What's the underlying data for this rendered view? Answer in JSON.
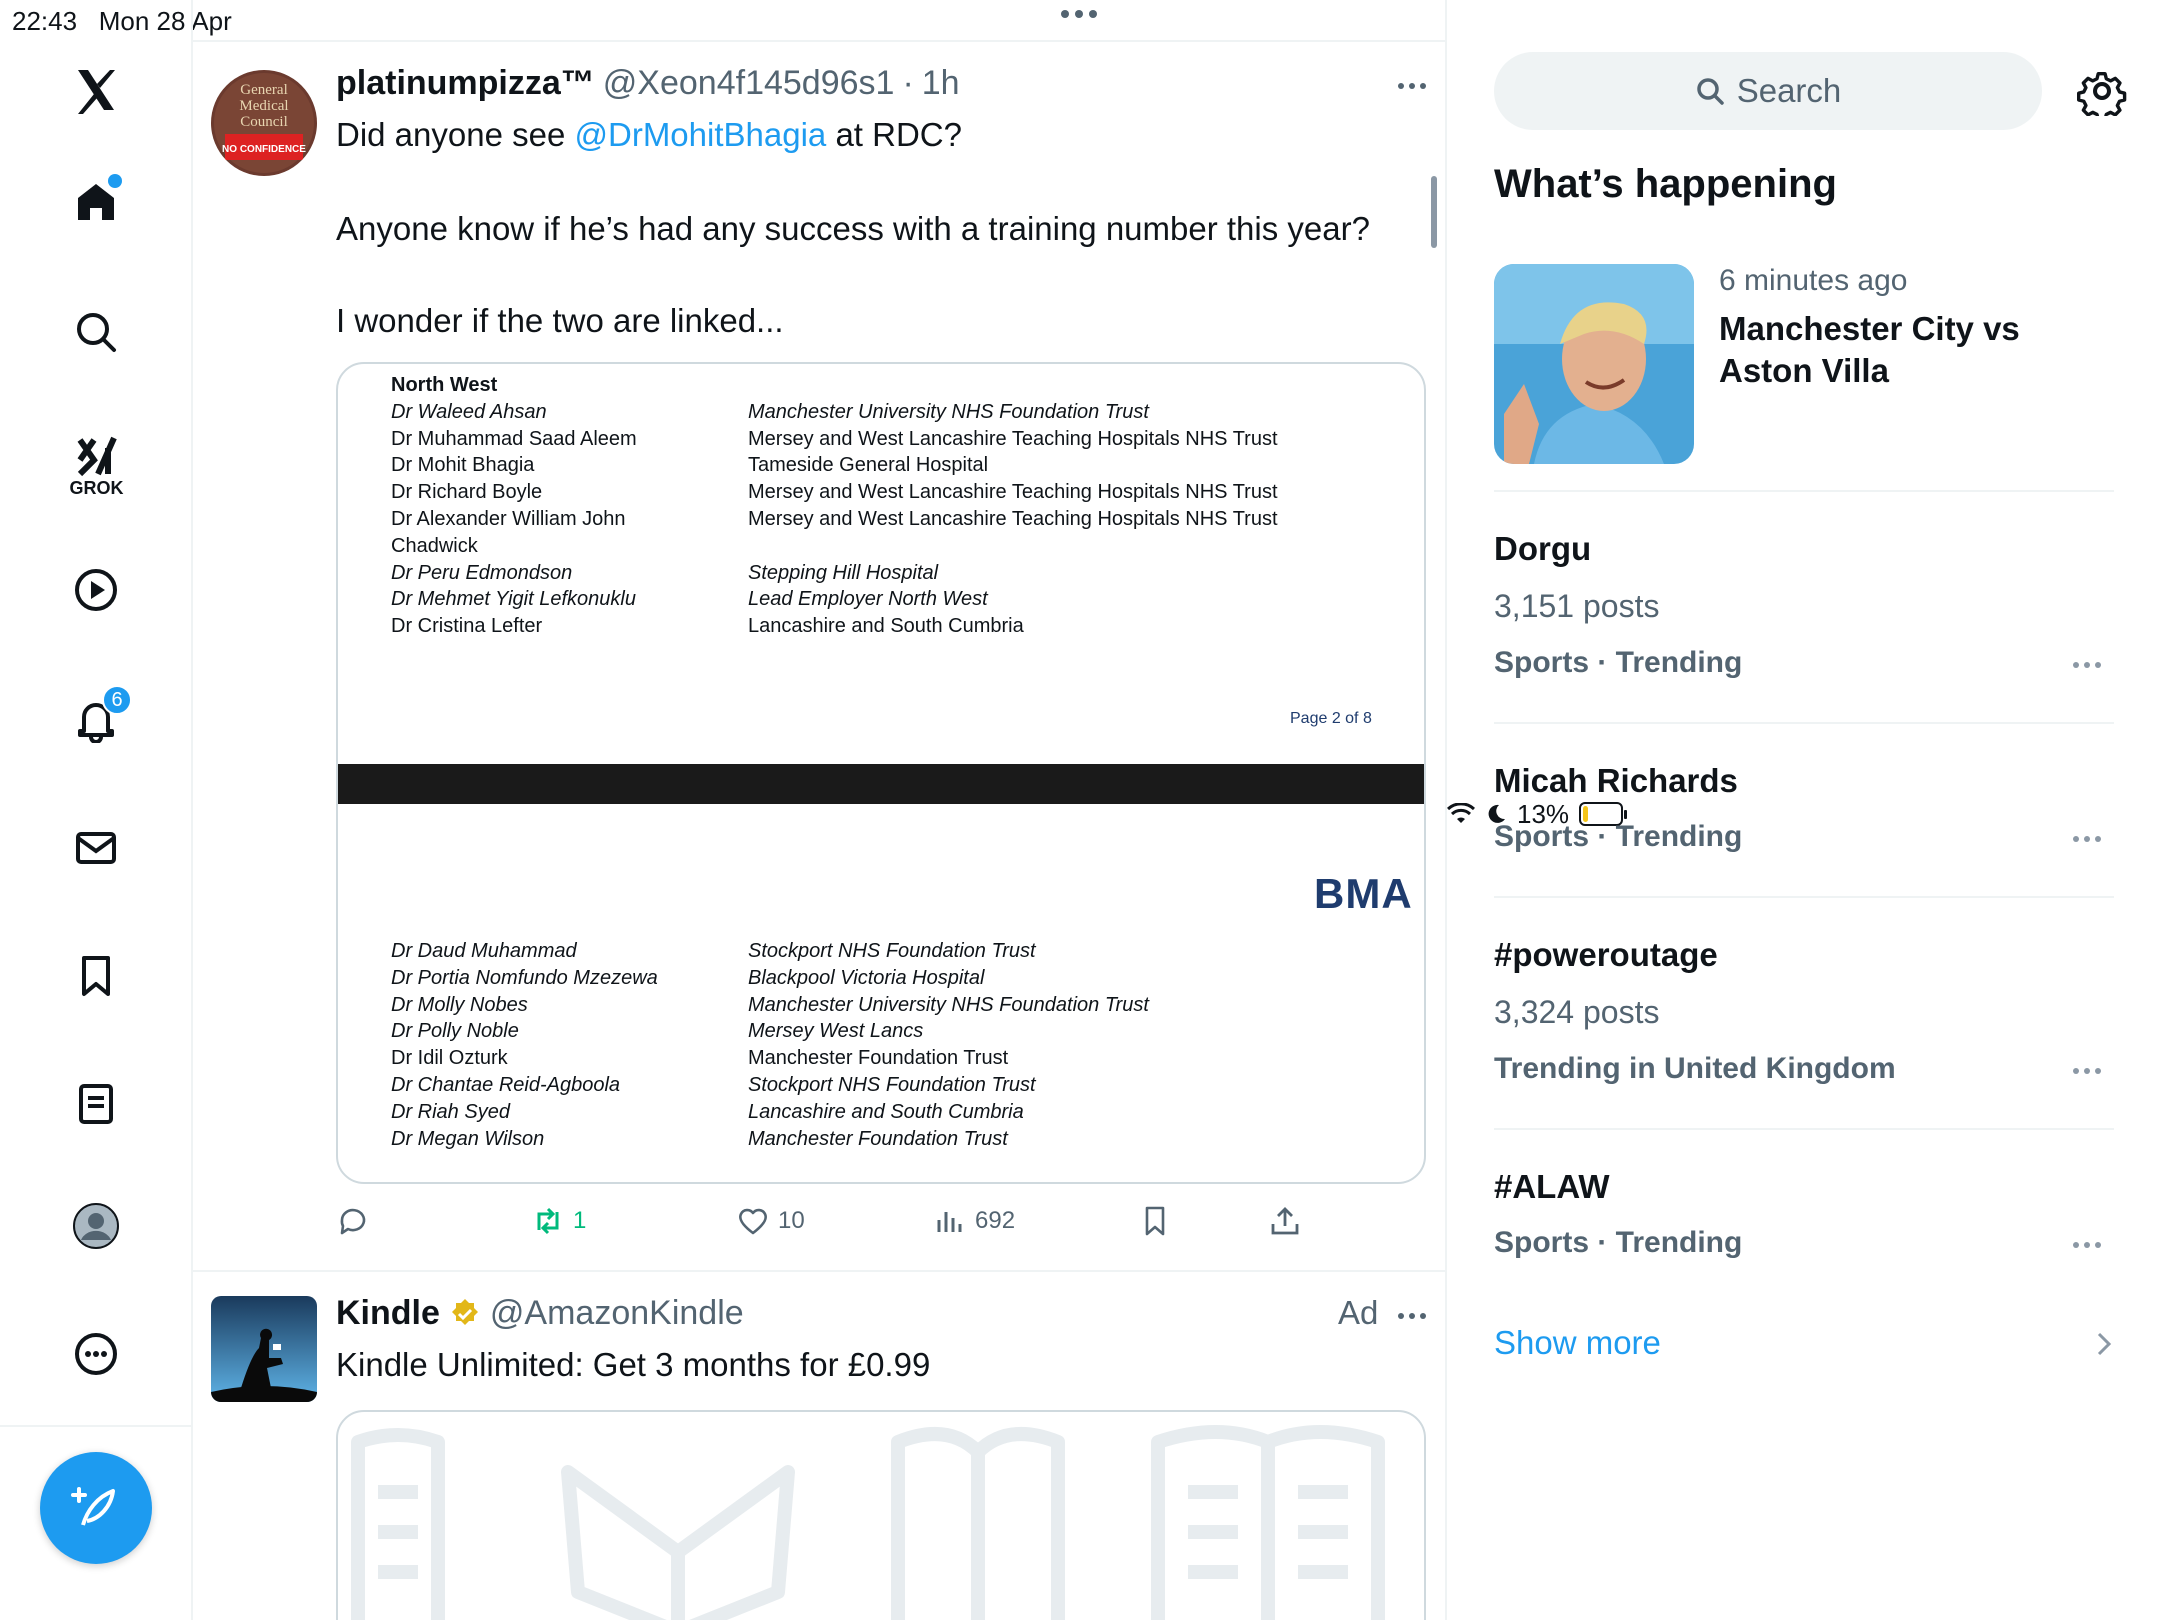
{
  "status_bar": {
    "time": "22:43",
    "date": "Mon 28 Apr",
    "battery": "13%",
    "battery_level": 0.13
  },
  "nav": {
    "grok_label": "GROK",
    "notifications_badge": "6",
    "icons": [
      "x-logo-icon",
      "home-icon",
      "search-icon",
      "grok-icon",
      "video-icon",
      "bell-icon",
      "mail-icon",
      "bookmark-icon",
      "lists-icon",
      "profile-icon",
      "more-icon",
      "compose-icon"
    ]
  },
  "tweet1": {
    "name": "platinumpizza™",
    "handle": "@Xeon4f145d96s1",
    "time": "1h",
    "text_line1_pre": "Did anyone see ",
    "mention": "@DrMohitBhagia",
    "text_line1_post": " at RDC?",
    "text_line2": "Anyone know if he’s had any success with a training number this year?",
    "text_line3": "I wonder if the two are linked...",
    "avatar_text": [
      "General",
      "Medical",
      "Council",
      "NO CONFIDENCE"
    ],
    "document": {
      "heading": "North West",
      "section1_names": [
        "Dr Waleed Ahsan",
        "Dr Muhammad Saad Aleem",
        "Dr Mohit Bhagia",
        "Dr Richard Boyle",
        "Dr Alexander William John",
        "Chadwick",
        "Dr Peru Edmondson",
        "Dr Mehmet Yigit Lefkonuklu",
        "Dr Cristina Lefter"
      ],
      "section1_trusts": [
        "Manchester University NHS Foundation Trust",
        "Mersey and West Lancashire Teaching Hospitals NHS Trust",
        "Tameside General Hospital",
        "Mersey and West Lancashire Teaching Hospitals NHS Trust",
        "Mersey and West Lancashire Teaching Hospitals NHS Trust",
        "",
        "Stepping Hill Hospital",
        "Lead Employer North West",
        "Lancashire and South Cumbria"
      ],
      "page_label": "Page 2 of 8",
      "logo": "BMA",
      "section2_names": [
        "Dr Daud Muhammad",
        "Dr Portia Nomfundo Mzezewa",
        "Dr Molly Nobes",
        "Dr Polly Noble",
        "Dr Idil Ozturk",
        "Dr Chantae Reid-Agboola",
        "Dr Riah Syed",
        "Dr Megan Wilson"
      ],
      "section2_trusts": [
        "Stockport NHS Foundation Trust",
        "Blackpool Victoria Hospital",
        "Manchester University NHS Foundation Trust",
        "Mersey West Lancs",
        "Manchester Foundation Trust",
        "Stockport NHS Foundation Trust",
        "Lancashire and South Cumbria",
        "Manchester Foundation Trust"
      ]
    },
    "reposts": "1",
    "likes": "10",
    "views": "692"
  },
  "tweet2": {
    "name": "Kindle",
    "handle": "@AmazonKindle",
    "ad_label": "Ad",
    "text": "Kindle Unlimited: Get 3 months for £0.99"
  },
  "sidebar": {
    "search_placeholder": "Search",
    "title": "What’s happening",
    "hero": {
      "time": "6 minutes ago",
      "title": "Manchester City vs Aston Villa"
    },
    "trends": [
      {
        "name": "Dorgu",
        "posts": "3,151 posts",
        "category": "Sports · Trending"
      },
      {
        "name": "Micah Richards",
        "posts": "",
        "category": "Sports · Trending"
      },
      {
        "name": "#poweroutage",
        "posts": "3,324 posts",
        "category": "Trending in United Kingdom"
      },
      {
        "name": "#ALAW",
        "posts": "",
        "category": "Sports · Trending"
      }
    ],
    "show_more": "Show more"
  }
}
